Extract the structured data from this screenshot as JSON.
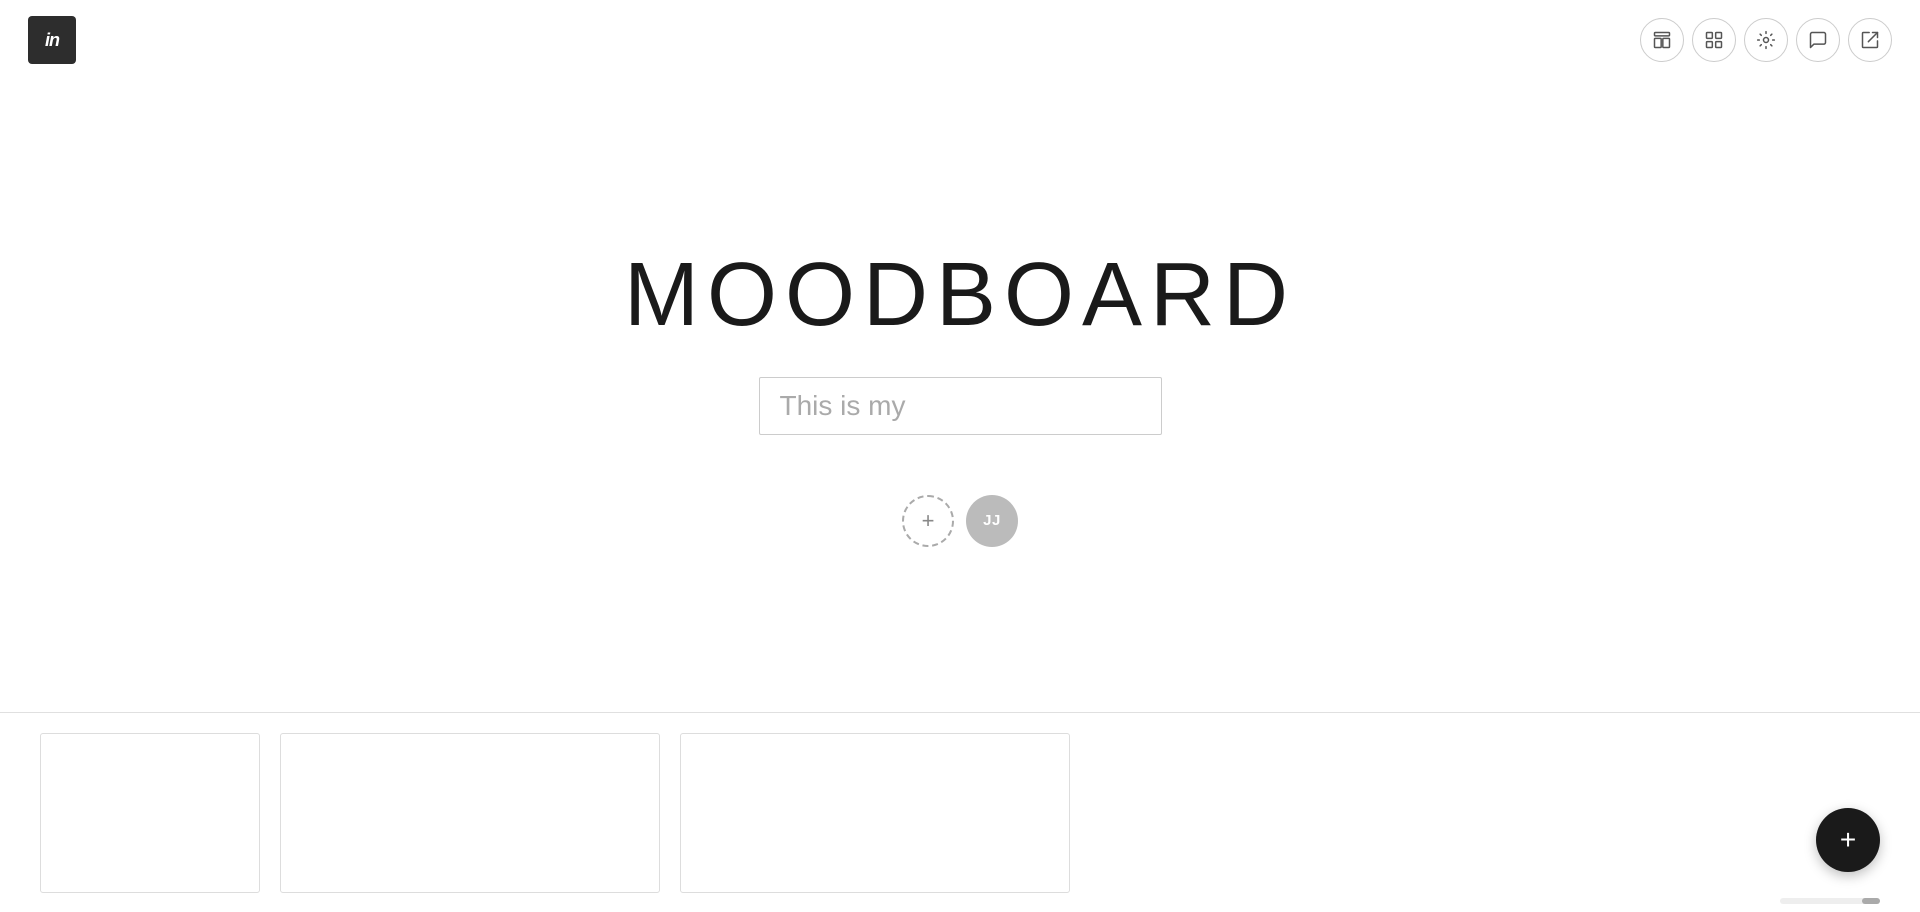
{
  "app": {
    "logo": "in",
    "title": "MOODBOARD"
  },
  "header": {
    "nav_buttons": [
      {
        "name": "layout-icon",
        "label": "Layout"
      },
      {
        "name": "grid-icon",
        "label": "Grid"
      },
      {
        "name": "settings-icon",
        "label": "Settings"
      },
      {
        "name": "comment-icon",
        "label": "Comment"
      },
      {
        "name": "share-icon",
        "label": "Share"
      }
    ]
  },
  "main": {
    "title": "MOODBOARD",
    "subtitle_input_value": "This is my",
    "subtitle_placeholder": "This is my"
  },
  "collaborators": {
    "add_label": "+",
    "user_initials": "JJ"
  },
  "fab": {
    "label": "+"
  },
  "board_cards": [
    {
      "id": "card-1"
    },
    {
      "id": "card-2"
    },
    {
      "id": "card-3"
    }
  ]
}
